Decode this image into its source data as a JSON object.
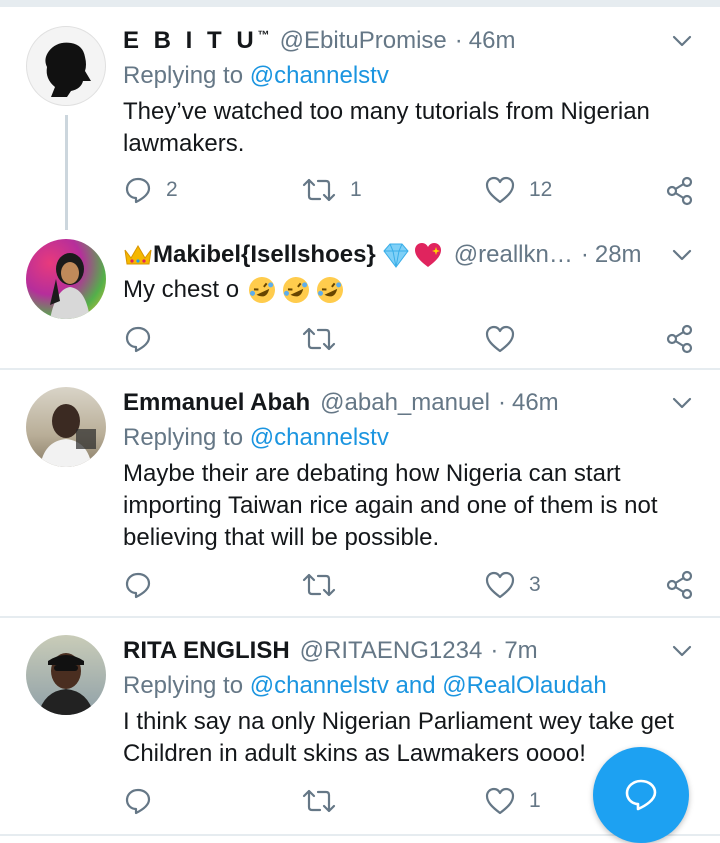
{
  "tweets": [
    {
      "name": "E B I T U",
      "name_suffix": "™",
      "handle": "@EbituPromise",
      "time": "46m",
      "replying_prefix": "Replying to",
      "replying_to": "@channelstv",
      "text": "They’ve watched too many tutorials from Nigerian lawmakers.",
      "replies": "2",
      "retweets": "1",
      "likes": "12"
    },
    {
      "name": "Makibel{Isellshoes}",
      "handle": "@reallkn…",
      "time": "28m",
      "text": "My chest o",
      "replies": "",
      "retweets": "",
      "likes": ""
    },
    {
      "name": "Emmanuel Abah",
      "handle": "@abah_manuel",
      "time": "46m",
      "replying_prefix": "Replying to",
      "replying_to": "@channelstv",
      "text": "Maybe their are debating how Nigeria can start importing Taiwan rice again and one of them is not believing that will be possible.",
      "replies": "",
      "retweets": "",
      "likes": "3"
    },
    {
      "name": "RITA ENGLISH",
      "handle": "@RITAENG1234",
      "time": "7m",
      "replying_prefix": "Replying to",
      "replying_to": "@channelstv and @RealOlaudah",
      "text": "I think say na only Nigerian Parliament wey take get Children in adult skins as Lawmakers oooo!",
      "replies": "",
      "retweets": "",
      "likes": "1"
    }
  ],
  "ui": {
    "dot": "·"
  },
  "colors": {
    "accent": "#1da1f2",
    "link": "#1b95e0",
    "muted": "#657786",
    "border": "#e6ecf0"
  },
  "icons": [
    "reply-icon",
    "retweet-icon",
    "like-icon",
    "share-icon",
    "chevron-down-icon",
    "compose-icon",
    "crown-emoji",
    "diamond-emoji",
    "sparkling-heart-emoji",
    "rofl-emoji"
  ]
}
